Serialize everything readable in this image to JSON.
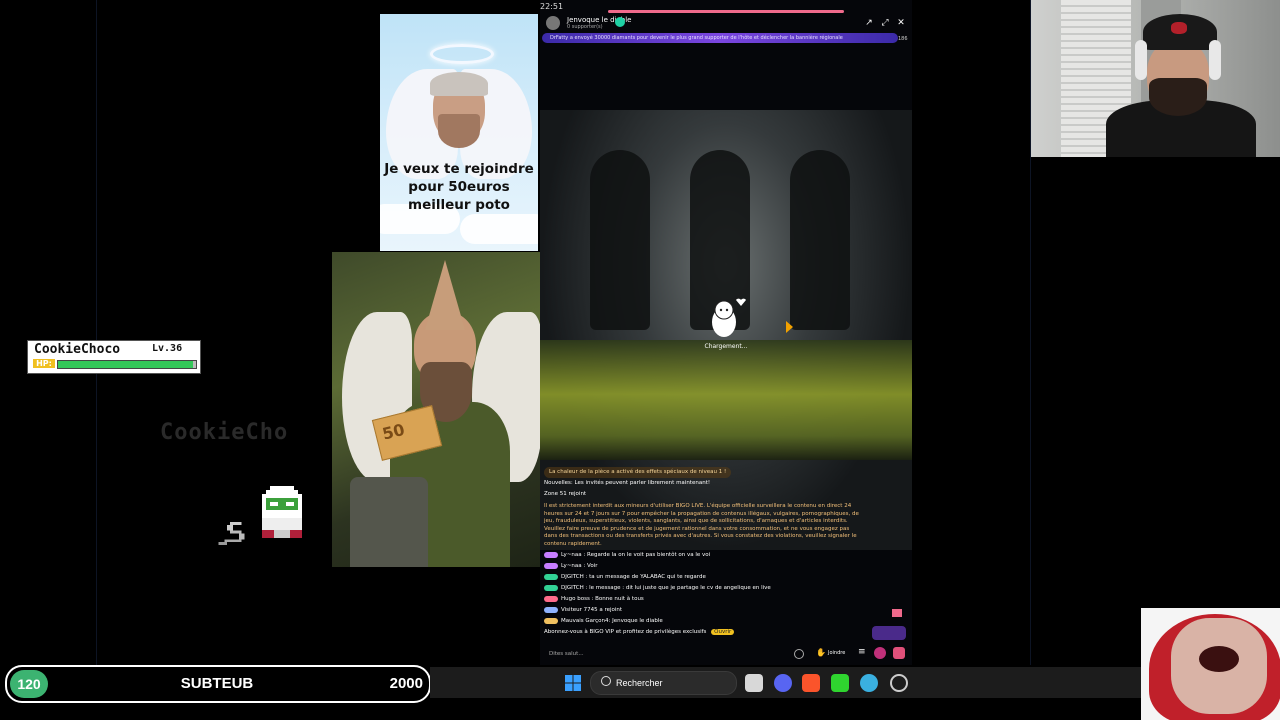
{
  "angel_card": {
    "caption": "Je veux te rejoindre pour 50euros meilleur poto"
  },
  "elf_photo": {
    "bill_value": "50"
  },
  "player_card": {
    "name": "CookieChoco",
    "level": "Lv.36",
    "hp_label": "HP:",
    "hp_fraction": 0.98,
    "ghost_name": "CookieCho"
  },
  "stream": {
    "status_time": "22:51",
    "title": "Jenvoque le diable",
    "subtitle": "0 supporter(s)",
    "banner": "DrFatty a envoyé 30000 diamants pour devenir le plus grand supporter de l'hôte et déclencher la bannière régionale",
    "viewers": "186",
    "loading": "Chargement...",
    "chat": {
      "heat": "La chaleur de la pièce a activé des effets spéciaux de niveau 1 !",
      "notice": "Nouvelles: Les invités peuvent parler librement maintenant!",
      "join1": "Zone 51 rejoint",
      "rules": "Il est strictement interdit aux mineurs d'utiliser BIGO LIVE. L'équipe officielle surveillera le contenu en direct 24 heures sur 24 et 7 jours sur 7 pour empêcher la propagation de contenus illégaux, vulgaires, pornographiques, de jeu, frauduleux, superstitieux, violents, sanglants, ainsi que de sollicitations, d'arnaques et d'articles interdits. Veuillez faire preuve de prudence et de jugement rationnel dans votre consommation, et ne vous engagez pas dans des transactions ou des transferts privés avec d'autres. Si vous constatez des violations, veuillez signaler le contenu rapidement.",
      "messages": [
        {
          "text": "Ly~naa : Regarde la on le voit pas bientôt on va le voi",
          "color": "#c77dff"
        },
        {
          "text": "Ly~naa : Voir",
          "color": "#c77dff"
        },
        {
          "text": "DJGITCH : ta un message de YALABAC qui te regarde",
          "color": "#32d296"
        },
        {
          "text": "DJGITCH : le message : dit lui juste que je partage le cv de angelique en live",
          "color": "#32d296"
        },
        {
          "text": "Hugo boss : Bonne nuit à tous",
          "color": "#ff6b8b"
        },
        {
          "text": "Visiteur 7745 a rejoint",
          "color": "#8fb3ff"
        },
        {
          "text": "Mauvais Garçon4: Jenvoque le diable",
          "color": "#f0c060"
        }
      ],
      "vip": "Abonnez-vous à BIGO VIP et profitez de privilèges exclusifs",
      "vip_badge": "Ouvrir"
    },
    "input_placeholder": "Dites salut...",
    "join_label": "Joindre"
  },
  "goal": {
    "current": "120",
    "label": "SUBTEUB",
    "target": "2000"
  },
  "taskbar": {
    "search_label": "Rechercher"
  }
}
